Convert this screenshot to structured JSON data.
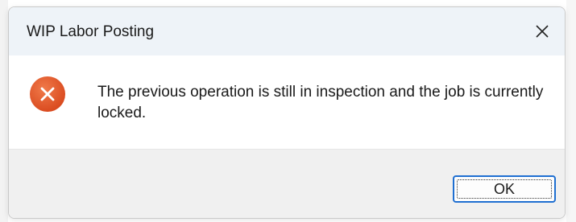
{
  "dialog": {
    "title": "WIP Labor Posting",
    "message": "The previous operation is still in inspection and the job is currently locked.",
    "icon": "error-icon",
    "buttons": {
      "ok_label": "OK"
    }
  },
  "colors": {
    "titlebar_bg": "#eef3f8",
    "error_icon_red": "#e35a2a",
    "footer_bg": "#f0f0f0",
    "ok_button_border": "#1f6fd1"
  }
}
